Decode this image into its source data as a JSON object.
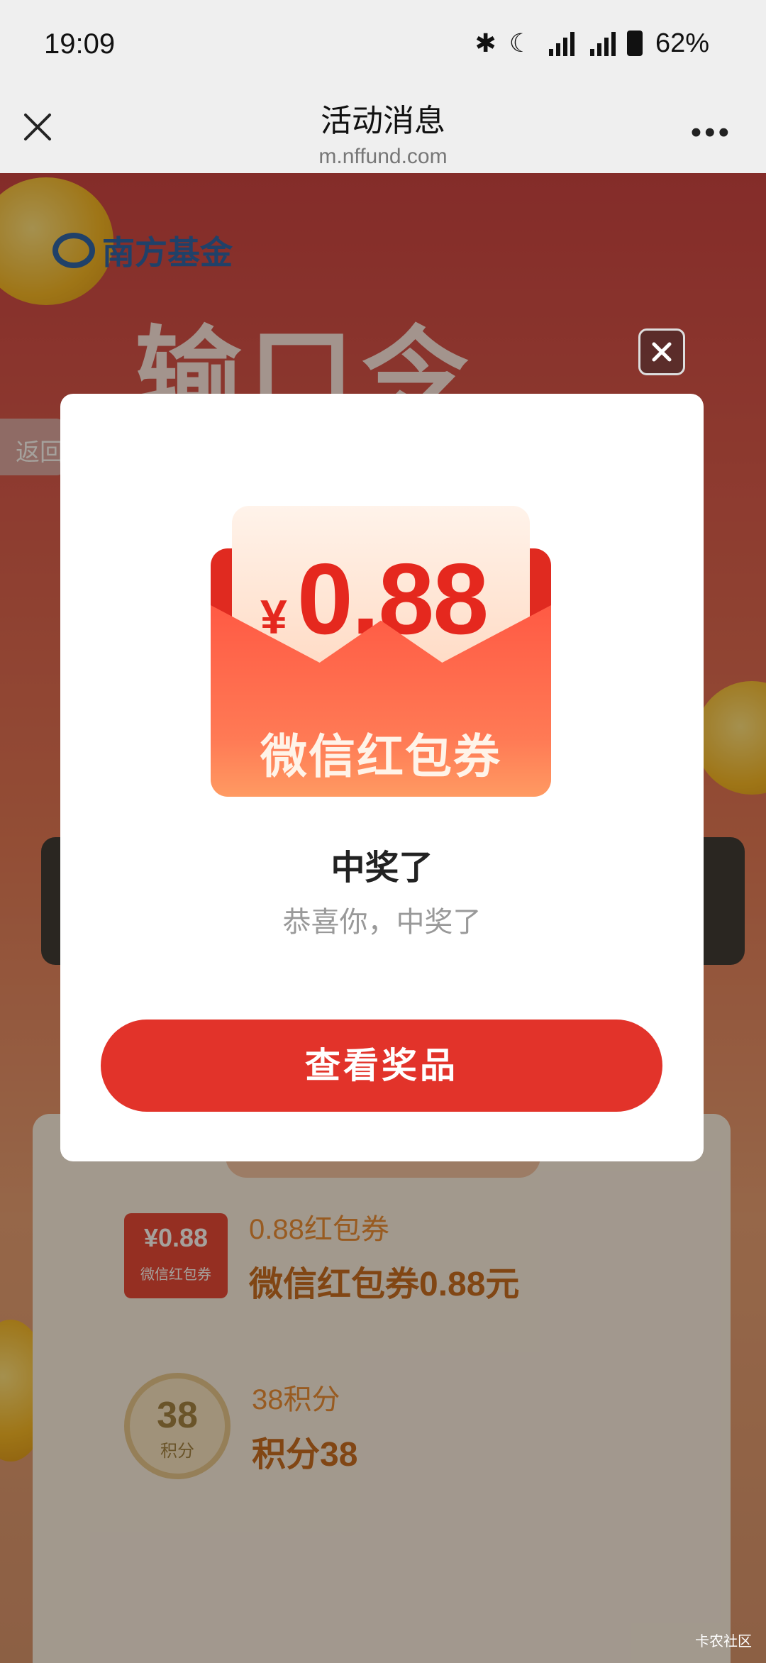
{
  "status_bar": {
    "time": "19:09",
    "battery_percent": "62%"
  },
  "nav": {
    "title": "活动消息",
    "url": "m.nffund.com",
    "more": "•••"
  },
  "background": {
    "logo_text": "南方基金",
    "banner_title": "输口令",
    "back_label": "返回",
    "prizes": [
      {
        "thumb_amount": "¥0.88",
        "thumb_label": "微信红包券",
        "name": "0.88红包券",
        "description": "微信红包券0.88元"
      },
      {
        "thumb_amount": "38",
        "thumb_label": "积分",
        "name": "38积分",
        "description": "积分38"
      }
    ]
  },
  "modal": {
    "currency": "¥",
    "amount": "0.88",
    "envelope_label": "微信红包券",
    "title": "中奖了",
    "subtitle": "恭喜你，中奖了",
    "button_label": "查看奖品"
  },
  "watermark": "卡农社区",
  "colors": {
    "accent_red": "#e2332a",
    "amount_red": "#e5281e"
  }
}
